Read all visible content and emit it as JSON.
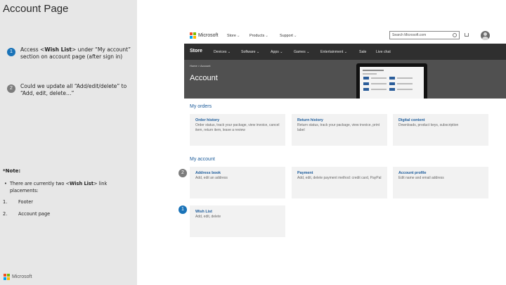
{
  "slide": {
    "title": "Account Page"
  },
  "steps": [
    {
      "number": "1",
      "text_before": "Access <",
      "bold": "Wish List",
      "text_after": "> under “My account” section on account page (after sign in)"
    },
    {
      "number": "2",
      "text": "Could we update all “Add/edit/delete” to “Add, edit, delete…”"
    }
  ],
  "note": {
    "title": "*Note:",
    "bullet_before": "There are currently two <",
    "bullet_bold": "Wish List",
    "bullet_after": "> link",
    "bullet_cont": "placements:",
    "list": [
      {
        "num": "1.",
        "text": "Footer"
      },
      {
        "num": "2.",
        "text": "Account page"
      }
    ]
  },
  "footer_brand": "Microsoft",
  "store": {
    "brand": "Microsoft",
    "top_nav": [
      "Store",
      "Products",
      "Support"
    ],
    "search_placeholder": "Search Microsoft.com",
    "store_label": "Store",
    "store_nav": [
      "Devices",
      "Software",
      "Apps",
      "Games",
      "Entertainment",
      "Sale",
      "Live chat"
    ],
    "breadcrumb": "Home  >  Account",
    "page_title": "Account",
    "my_orders": {
      "title": "My orders",
      "cards": [
        {
          "title": "Order history",
          "desc": "Order status, track your package, view invoice, cancel item, return item, leave a review"
        },
        {
          "title": "Return history",
          "desc": "Return status, track your package, view invoice, print label"
        },
        {
          "title": "Digital content",
          "desc": "Downloads, product keys, subscription"
        }
      ]
    },
    "my_account": {
      "title": "My account",
      "cards": [
        {
          "title": "Address book",
          "desc": "Add, edit an address"
        },
        {
          "title": "Payment",
          "desc": "Add, edit, delete payment method: credit card, PayPal"
        },
        {
          "title": "Account profile",
          "desc": "Edit name and email address"
        },
        {
          "title": "Wish List",
          "desc": "Add, edit, delete"
        }
      ]
    },
    "callouts": [
      "2",
      "1"
    ]
  },
  "colors": {
    "link_blue": "#1a5a9a",
    "badge_blue": "#1a73b8",
    "badge_gray": "#7c7c7c",
    "store_bar": "#2f2f2f",
    "hero": "#505050"
  }
}
